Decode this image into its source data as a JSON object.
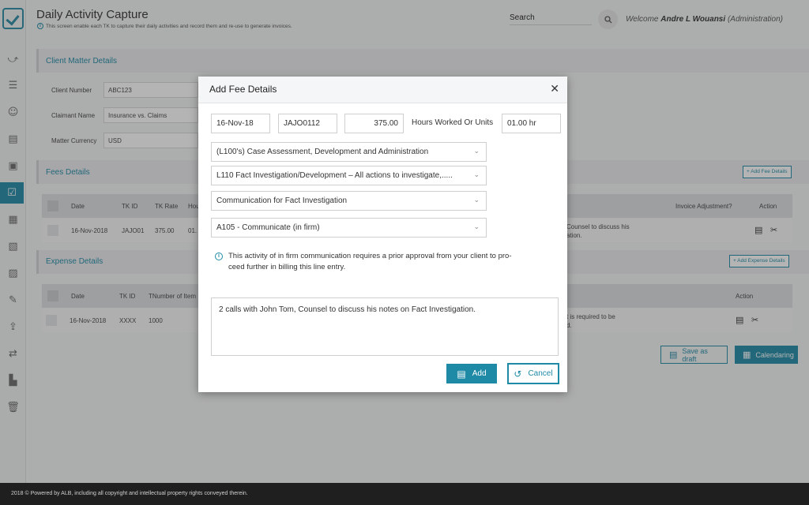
{
  "header": {
    "title": "Daily Activity Capture",
    "subtitle": "This screen enable each TK to capture their daily activities and record them and re-use to generate invoices.",
    "search_label": "Search",
    "welcome_prefix": "Welcome",
    "user_name": "Andre L Wouansi",
    "user_role": "(Administration)"
  },
  "sidebar": {
    "items": [
      "activity-icon",
      "list-icon",
      "user-icon",
      "report-icon",
      "id-card-icon",
      "check-icon",
      "calendar-icon",
      "document-icon",
      "notes-icon",
      "edit-icon",
      "upload-icon",
      "transfer-icon",
      "chart-icon",
      "trash-icon"
    ],
    "active_index": 5
  },
  "client_matter": {
    "title": "Client Matter Details",
    "client_number_label": "Client Number",
    "client_number_value": "ABC123",
    "claimant_name_label": "Claimant Name",
    "claimant_name_value": "Insurance vs. Claims",
    "matter_currency_label": "Matter Currency",
    "matter_currency_value": "USD"
  },
  "fees": {
    "title": "Fees Details",
    "add_button": "+ Add Fee Details",
    "columns": [
      "Date",
      "TK ID",
      "TK Rate",
      "Hou",
      "Invoice Adjustment?",
      "Action"
    ],
    "row": {
      "date": "16-Nov-2018",
      "tk_id": "JAJO01",
      "tk_rate": "375.00",
      "hours": "01.",
      "narrative_line1": "Counsel to discuss his",
      "narrative_line2": "ation."
    }
  },
  "expenses": {
    "title": "Expense Details",
    "add_button": "+ Add Expense Details",
    "columns": [
      "Date",
      "TK ID",
      "TNumber of Item",
      "Action"
    ],
    "row": {
      "date": "16-Nov-2018",
      "tk_id": "XXXX",
      "items": "1000",
      "narrative_line1": "t is required to be",
      "narrative_line2": "d."
    }
  },
  "actions": {
    "save_draft": "Save as draft",
    "calendaring": "Calendaring"
  },
  "modal": {
    "title": "Add Fee Details",
    "date": "16-Nov-18",
    "tk_id": "JAJO0112",
    "rate": "375.00",
    "hours_label": "Hours Worked Or Units",
    "hours_value": "01.00 hr",
    "select_phase": "(L100's) Case Assessment, Development and Administration",
    "select_task": "L110 Fact Investigation/Development – All actions to investigate,.....",
    "select_activity": "Communication for Fact Investigation",
    "select_code": "A105 - Communicate (in firm)",
    "note_line1": "This activity of in firm communication requires a prior approval from your client to pro-",
    "note_line2": "ceed further in billing this line entry.",
    "narrative": "2 calls with John Tom, Counsel to discuss his notes on Fact Investigation.",
    "add_label": "Add",
    "cancel_label": "Cancel"
  },
  "footer": {
    "text": "2018 © Powered by ALB, including all copyright and intellectual property rights conveyed therein."
  },
  "colors": {
    "accent": "#1f8aa6",
    "footer_bg": "#1f1f1f"
  }
}
